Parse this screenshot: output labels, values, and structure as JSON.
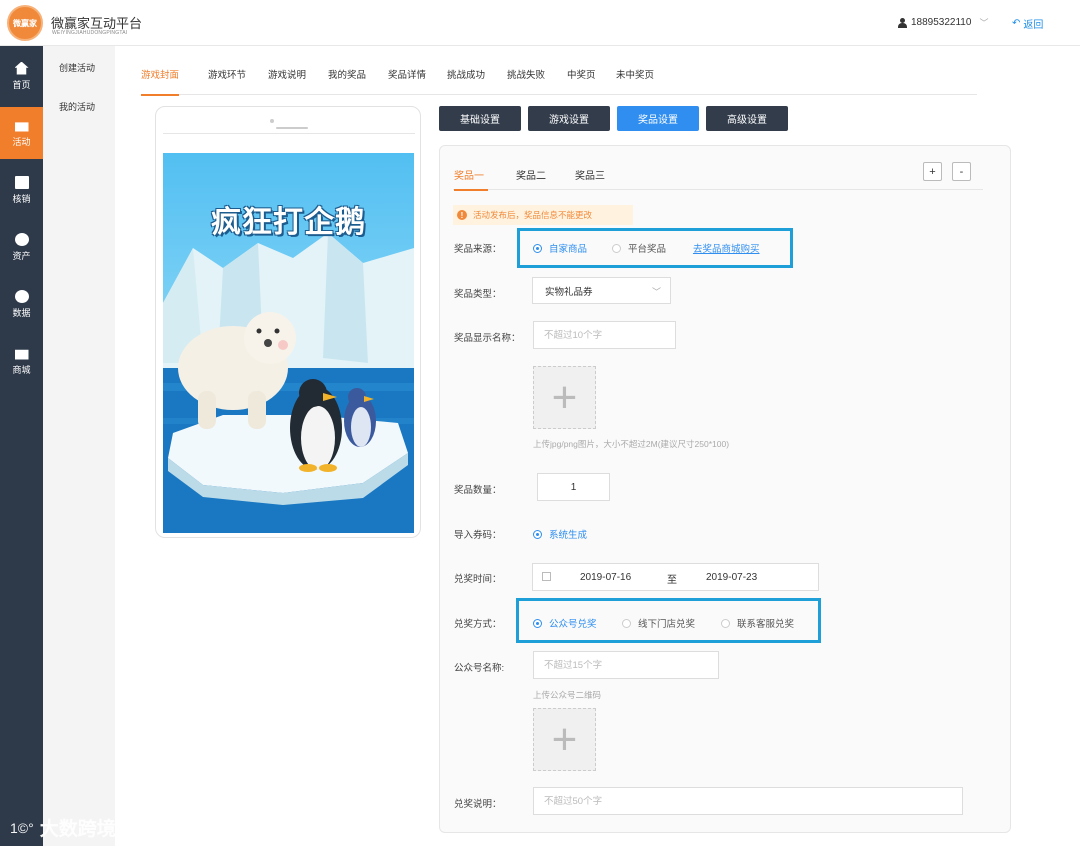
{
  "header": {
    "logo_text": "微赢家",
    "brand_title": "微赢家互动平台",
    "brand_subtitle": "WEIYINGJIAHUDONGPINGTAI",
    "user_phone": "18895322110",
    "back_label": "返回"
  },
  "leftnav": {
    "items": [
      {
        "label": "首页",
        "icon": "home-icon"
      },
      {
        "label": "活动",
        "icon": "gift-icon"
      },
      {
        "label": "核销",
        "icon": "document-icon"
      },
      {
        "label": "资产",
        "icon": "pie-icon"
      },
      {
        "label": "数据",
        "icon": "pie-icon"
      },
      {
        "label": "商城",
        "icon": "store-icon"
      }
    ]
  },
  "subnav": {
    "items": [
      {
        "label": "创建活动"
      },
      {
        "label": "我的活动"
      }
    ]
  },
  "tabs": [
    {
      "label": "游戏封面"
    },
    {
      "label": "游戏环节"
    },
    {
      "label": "游戏说明"
    },
    {
      "label": "我的奖品"
    },
    {
      "label": "奖品详情"
    },
    {
      "label": "挑战成功"
    },
    {
      "label": "挑战失败"
    },
    {
      "label": "中奖页"
    },
    {
      "label": "未中奖页"
    }
  ],
  "preview": {
    "game_title": "疯狂打企鹅"
  },
  "settings_buttons": [
    {
      "label": "基础设置"
    },
    {
      "label": "游戏设置"
    },
    {
      "label": "奖品设置"
    },
    {
      "label": "高级设置"
    }
  ],
  "prize_tabs": [
    {
      "label": "奖品一"
    },
    {
      "label": "奖品二"
    },
    {
      "label": "奖品三"
    }
  ],
  "add_label": "+",
  "remove_label": "-",
  "warning": "活动发布后，奖品信息不能更改",
  "form": {
    "source_label": "奖品来源：",
    "source_options": [
      "自家商品",
      "平台奖品"
    ],
    "source_link": "去奖品商城购买",
    "type_label": "奖品类型：",
    "type_value": "实物礼品券",
    "name_label": "奖品显示名称：",
    "name_placeholder": "不超过10个字",
    "upload_hint": "上传jpg/png图片，大小不超过2M(建议尺寸250*100)",
    "qty_label": "奖品数量：",
    "qty_value": "1",
    "code_label": "导入券码：",
    "code_option": "系统生成",
    "time_label": "兑奖时间：",
    "date_start": "2019-07-16",
    "date_to": "至",
    "date_end": "2019-07-23",
    "method_label": "兑奖方式：",
    "method_options": [
      "公众号兑奖",
      "线下门店兑奖",
      "联系客服兑奖"
    ],
    "account_label": "公众号名称:",
    "account_placeholder": "不超过15个字",
    "qr_hint": "上传公众号二维码",
    "desc_label": "兑奖说明：",
    "desc_placeholder": "不超过50个字"
  },
  "watermark": {
    "mark": "1©°",
    "text": "大数跨境"
  },
  "colors": {
    "accent_orange": "#f07e2b",
    "nav_dark": "#2e3a4a",
    "primary_blue": "#2f8ef0",
    "highlight_cyan": "#1e9fd8"
  }
}
